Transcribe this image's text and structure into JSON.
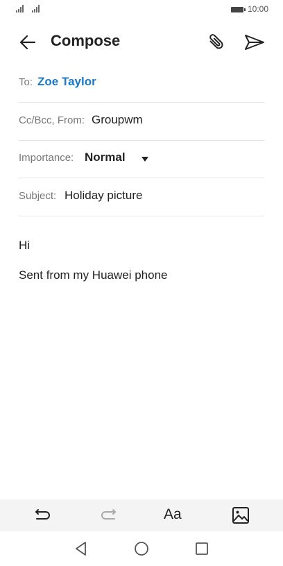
{
  "status_bar": {
    "time": "10:00"
  },
  "header": {
    "title": "Compose"
  },
  "fields": {
    "to_label": "To:",
    "to_value": "Zoe Taylor",
    "ccbcc_label": "Cc/Bcc, From:",
    "ccbcc_value": "Groupwm",
    "importance_label": "Importance:",
    "importance_value": "Normal",
    "subject_label": "Subject:",
    "subject_value": "Holiday picture"
  },
  "body": {
    "line1": "Hi",
    "line2": "Sent from my Huawei phone"
  },
  "toolbar": {
    "format_label": "Aa"
  },
  "icons": {
    "back": "arrow-left-icon",
    "attach": "paperclip-icon",
    "send": "send-icon",
    "undo": "undo-icon",
    "redo": "redo-icon",
    "image": "image-icon",
    "nav_back": "triangle-back-icon",
    "nav_home": "circle-home-icon",
    "nav_recents": "square-recents-icon"
  },
  "colors": {
    "accent": "#1a78c8",
    "toolbar_bg": "#f4f4f4"
  }
}
